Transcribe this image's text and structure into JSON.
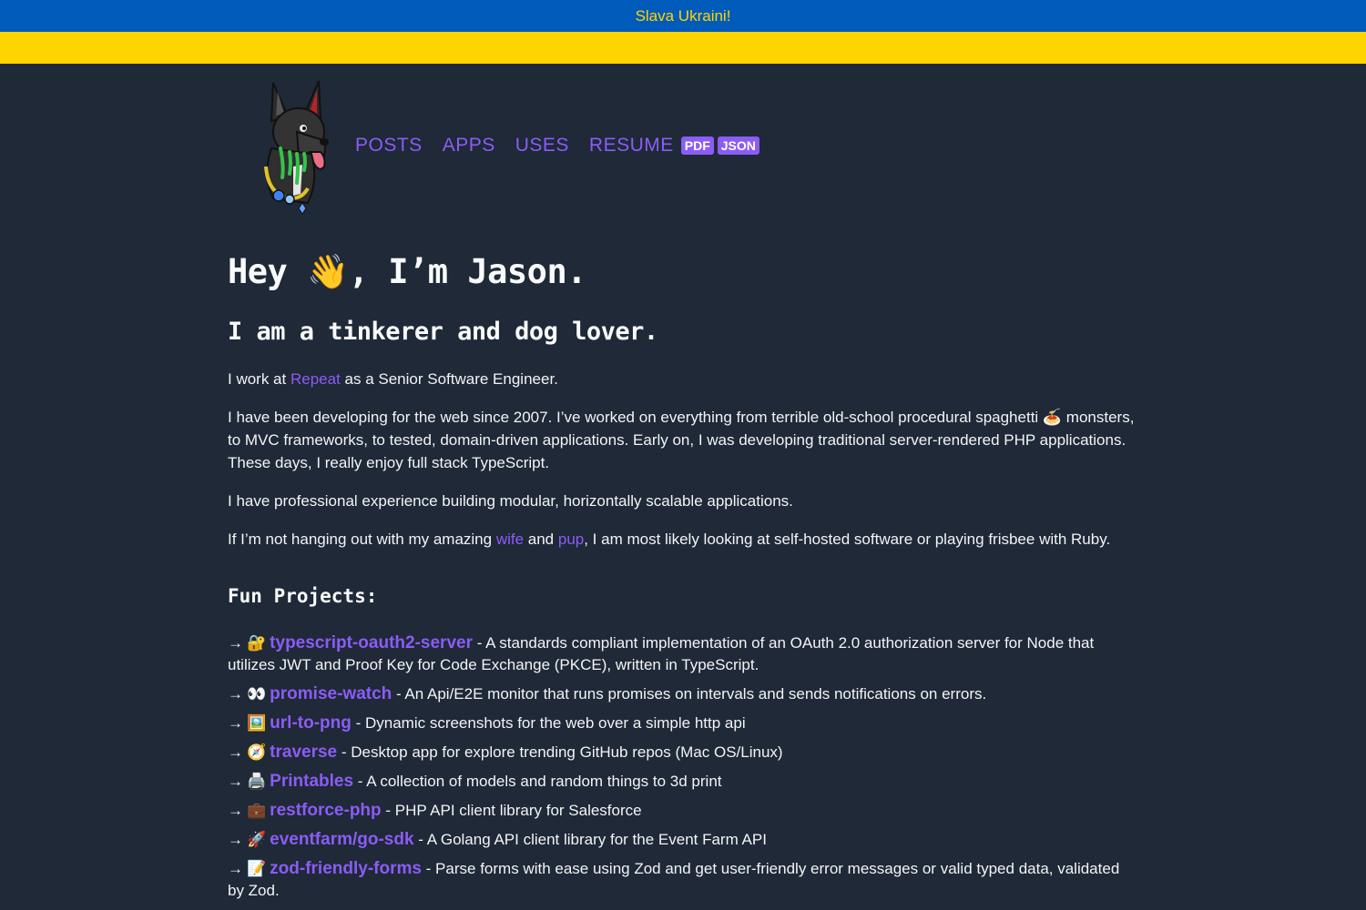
{
  "banner": {
    "text": "Slava Ukraini!",
    "color_blue": "#005bbb",
    "color_yellow": "#ffd500"
  },
  "nav": {
    "logo": "dog-avatar-icon",
    "links": [
      "POSTS",
      "APPS",
      "USES",
      "RESUME"
    ],
    "resume_badges": [
      "PDF",
      "JSON"
    ]
  },
  "hero": {
    "greeting_pre": "Hey ",
    "greeting_emoji": "👋",
    "greeting_post": ", I’m Jason.",
    "tagline": "I am a tinkerer and dog lover."
  },
  "about": {
    "p1_pre": "I work at ",
    "p1_link": "Repeat",
    "p1_post": " as a Senior Software Engineer.",
    "p2": "I have been developing for the web since 2007. I’ve worked on everything from terrible old-school procedural spaghetti 🍝 monsters, to MVC frameworks, to tested, domain-driven applications. Early on, I was developing traditional server-rendered PHP applications. These days, I really enjoy full stack TypeScript.",
    "p3": "I have professional experience building modular, horizontally scalable applications.",
    "p4_pre": "If I’m not hanging out with my amazing ",
    "p4_link1": "wife",
    "p4_mid": " and ",
    "p4_link2": "pup",
    "p4_post": ", I am most likely looking at self-hosted software or playing frisbee with Ruby."
  },
  "projects": {
    "title": "Fun Projects:",
    "arrow": "→",
    "items": [
      {
        "emoji": "🔐",
        "name": "typescript-oauth2-server",
        "desc": " - A standards compliant implementation of an OAuth 2.0 authorization server for Node that utilizes JWT and Proof Key for Code Exchange (PKCE), written in TypeScript."
      },
      {
        "emoji": "👀",
        "name": "promise-watch",
        "desc": " - An Api/E2E monitor that runs promises on intervals and sends notifications on errors."
      },
      {
        "emoji": "🖼️",
        "name": "url-to-png",
        "desc": " - Dynamic screenshots for the web over a simple http api"
      },
      {
        "emoji": "🧭",
        "name": "traverse",
        "desc": " - Desktop app for explore trending GitHub repos (Mac OS/Linux)"
      },
      {
        "emoji": "🖨️",
        "name": "Printables",
        "desc": " - A collection of models and random things to 3d print"
      },
      {
        "emoji": "💼",
        "name": "restforce-php",
        "desc": " - PHP API client library for Salesforce"
      },
      {
        "emoji": "🚀",
        "name": "eventfarm/go-sdk",
        "desc": " - A Golang API client library for the Event Farm API"
      },
      {
        "emoji": "📝",
        "name": "zod-friendly-forms",
        "desc": " - Parse forms with ease using Zod and get user-friendly error messages or valid typed data, validated by Zod."
      }
    ]
  },
  "colors": {
    "background": "#1f2937",
    "accent": "#8b5cf6",
    "text": "#f3f4f6"
  }
}
